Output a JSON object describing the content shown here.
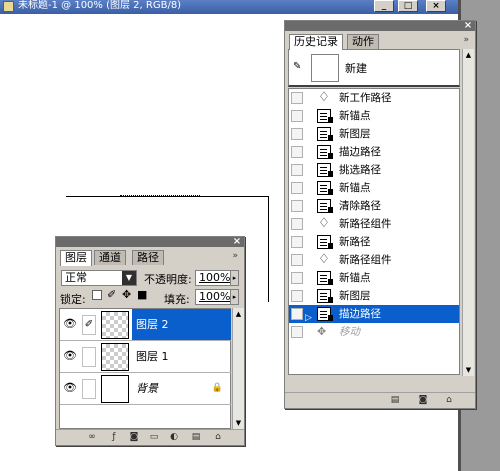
{
  "document": {
    "title": "未标题-1 @ 100% (图层 2, RGB/8)",
    "buttons": {
      "minimize": "_",
      "maximize": "□",
      "close": "×"
    }
  },
  "history_panel": {
    "tabs": [
      {
        "label": "历史记录",
        "active": true
      },
      {
        "label": "动作",
        "active": false
      }
    ],
    "more": "»",
    "close": "×",
    "snapshot_label": "新建",
    "items": [
      {
        "label": "新工作路径",
        "icon": "pen-icon",
        "state": "normal"
      },
      {
        "label": "新锚点",
        "icon": "history-state-icon",
        "state": "normal"
      },
      {
        "label": "新图层",
        "icon": "history-state-icon",
        "state": "normal"
      },
      {
        "label": "描边路径",
        "icon": "history-state-icon",
        "state": "normal"
      },
      {
        "label": "挑选路径",
        "icon": "history-state-icon",
        "state": "normal"
      },
      {
        "label": "新锚点",
        "icon": "history-state-icon",
        "state": "normal"
      },
      {
        "label": "清除路径",
        "icon": "history-state-icon",
        "state": "normal"
      },
      {
        "label": "新路径组件",
        "icon": "pen-icon",
        "state": "normal"
      },
      {
        "label": "新路径",
        "icon": "history-state-icon",
        "state": "normal"
      },
      {
        "label": "新路径组件",
        "icon": "pen-icon",
        "state": "normal"
      },
      {
        "label": "新锚点",
        "icon": "history-state-icon",
        "state": "normal"
      },
      {
        "label": "新图层",
        "icon": "history-state-icon",
        "state": "normal"
      },
      {
        "label": "描边路径",
        "icon": "history-state-icon",
        "state": "selected"
      },
      {
        "label": "移动",
        "icon": "move-icon",
        "state": "dim"
      }
    ],
    "bottom_buttons": [
      "new-document-from-state",
      "new-snapshot",
      "delete-state"
    ]
  },
  "layers_panel": {
    "tabs": [
      {
        "label": "图层",
        "active": true
      },
      {
        "label": "通道",
        "active": false
      },
      {
        "label": "路径",
        "active": false
      }
    ],
    "more": "»",
    "close": "×",
    "blend_mode": "正常",
    "opacity_label": "不透明度:",
    "opacity_value": "100%",
    "lock_label": "锁定:",
    "fill_label": "填充:",
    "fill_value": "100%",
    "layers": [
      {
        "name": "图层 2",
        "selected": true,
        "thumb": "transparent"
      },
      {
        "name": "图层 1",
        "selected": false,
        "thumb": "transparent"
      },
      {
        "name": "背景",
        "selected": false,
        "thumb": "white",
        "locked": true
      }
    ]
  },
  "colors": {
    "selection": "#0a5fcc",
    "panel_bg": "#d4d0c8",
    "title_blue": "#3b5fa6"
  }
}
